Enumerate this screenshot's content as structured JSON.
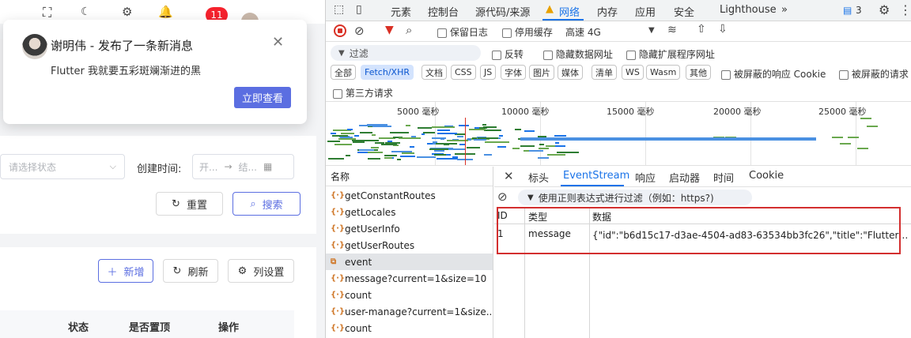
{
  "app": {
    "header_badge": "11",
    "notification": {
      "title": "谢明伟 - 发布了一条新消息",
      "message": "Flutter 我就要五彩斑斓渐进的黑",
      "action_label": "立即查看",
      "close_glyph": "✕"
    },
    "filters": {
      "status_placeholder": "请选择状态",
      "created_time_label": "创建时间:",
      "date_start": "开...",
      "date_end": "结...",
      "reset_label": "重置",
      "search_label": "搜索"
    },
    "toolbar": {
      "add_label": "新增",
      "refresh_label": "刷新",
      "columns_label": "列设置"
    },
    "table_headers": [
      "状态",
      "是否置顶",
      "操作"
    ]
  },
  "devtools": {
    "tabs": [
      "元素",
      "控制台",
      "源代码/来源",
      "网络",
      "内存",
      "应用",
      "安全",
      "Lighthouse"
    ],
    "active_tab": "网络",
    "more_tabs": "»",
    "message_count": "3",
    "toolbar": {
      "preserve_log": "保留日志",
      "disable_cache": "停用缓存",
      "throttle": "高速 4G"
    },
    "filter": {
      "placeholder": "过滤",
      "invert": "反转",
      "hide_data_urls": "隐藏数据网址",
      "hide_ext_urls": "隐藏扩展程序网址"
    },
    "type_chips": [
      "全部",
      "Fetch/XHR",
      "文档",
      "CSS",
      "JS",
      "字体",
      "图片",
      "媒体",
      "清单",
      "WS",
      "Wasm",
      "其他"
    ],
    "active_chip": "Fetch/XHR",
    "blocked_cookies": "被屏蔽的响应 Cookie",
    "blocked_requests": "被屏蔽的请求",
    "third_party": "第三方请求",
    "timeline_ticks": [
      "5000 毫秒",
      "10000 毫秒",
      "15000 毫秒",
      "20000 毫秒",
      "25000 毫秒"
    ],
    "name_header": "名称",
    "requests": [
      "getConstantRoutes",
      "getLocales",
      "getUserInfo",
      "getUserRoutes",
      "event",
      "message?current=1&size=10",
      "count",
      "user-manage?current=1&size...",
      "count"
    ],
    "selected_request": "event",
    "detail_tabs": [
      "标头",
      "EventStream",
      "响应",
      "启动器",
      "时间",
      "Cookie"
    ],
    "active_detail_tab": "EventStream",
    "regex_filter": "使用正则表达式进行过滤（例如：https?)",
    "stream_columns": [
      "ID",
      "类型",
      "数据"
    ],
    "stream_rows": [
      {
        "id": "1",
        "type": "message",
        "data": "{\"id\":\"b6d15c17-d3ae-4504-ad83-63534bb3fc26\",\"title\":\"Flutter 我..."
      }
    ],
    "highlight_color": "#d32f2f",
    "accent_color": "#1a73e8"
  }
}
